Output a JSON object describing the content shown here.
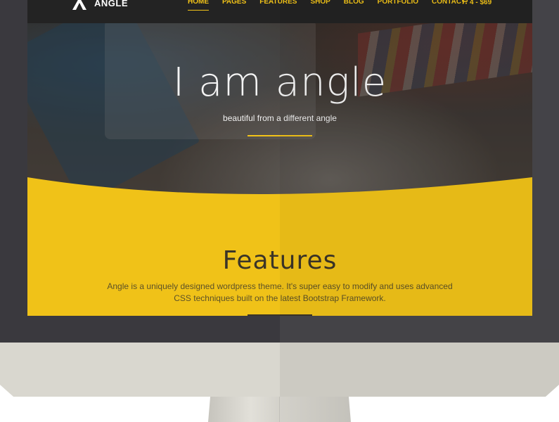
{
  "site": {
    "logo_text": "ANGLE"
  },
  "nav": {
    "items": [
      {
        "label": "HOME",
        "active": true
      },
      {
        "label": "PAGES",
        "active": false
      },
      {
        "label": "FEATURES",
        "active": false
      },
      {
        "label": "SHOP",
        "active": false
      },
      {
        "label": "BLOG",
        "active": false
      },
      {
        "label": "PORTFOLIO",
        "active": false
      },
      {
        "label": "CONTACT",
        "active": false
      }
    ],
    "cart_label": "4 - $69"
  },
  "hero": {
    "title": "I am angle",
    "subtitle": "beautiful from a different angle"
  },
  "features": {
    "title": "Features",
    "description": "Angle is a uniquely designed wordpress theme. It's super easy to modify and uses advanced CSS techniques built on the latest Bootstrap Framework."
  },
  "colors": {
    "accent": "#f2c318",
    "navbar": "#232323",
    "features_bg": "#f0c218",
    "bezel": "#3a393e",
    "chin": "#d9d7cf"
  },
  "icons": {
    "logo": "angle-logo-icon",
    "cart": "shopping-cart-icon"
  }
}
